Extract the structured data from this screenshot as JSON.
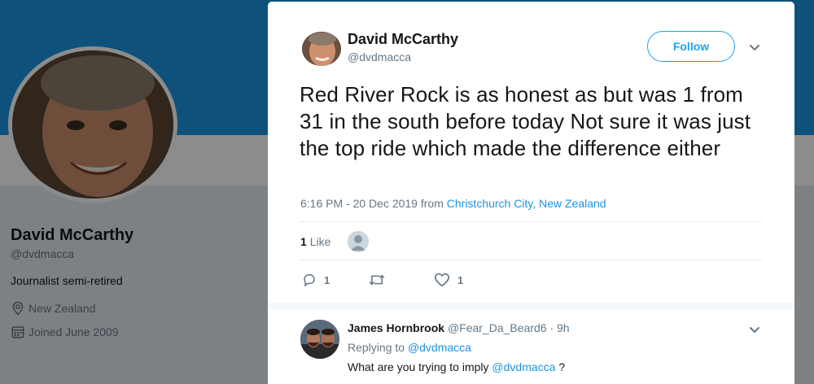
{
  "profile": {
    "name": "David McCarthy",
    "handle": "@dvdmacca",
    "bio": "Journalist semi-retired",
    "location": "New Zealand",
    "joined": "Joined June 2009",
    "icons": {
      "location": "location-pin-icon",
      "joined": "calendar-icon"
    },
    "colors": {
      "banner": "#1b95e0"
    }
  },
  "tweet": {
    "author_name": "David McCarthy",
    "author_handle": "@dvdmacca",
    "follow_label": "Follow",
    "text": "Red River Rock is as honest as but was 1 from 31 in the south before today Not sure it was just the top ride which made the difference either",
    "timestamp": "6:16 PM - 20 Dec 2019 from ",
    "location": "Christchurch City, New Zealand",
    "like_count": "1",
    "like_word": "Like",
    "actions": {
      "reply_count": "1",
      "retweet_count": "",
      "like_count": "1"
    }
  },
  "reply": {
    "name": "James Hornbrook",
    "handle": "@Fear_Da_Beard6",
    "dot": "·",
    "time": "9h",
    "replying_prefix": "Replying to ",
    "replying_to": "@dvdmacca",
    "text_prefix": "What are you trying to imply ",
    "text_mention": "@dvdmacca",
    "text_suffix": " ?"
  },
  "colors": {
    "accent": "#1da1f2",
    "link": "#1b95e0",
    "muted": "#657786",
    "text": "#14171a"
  }
}
